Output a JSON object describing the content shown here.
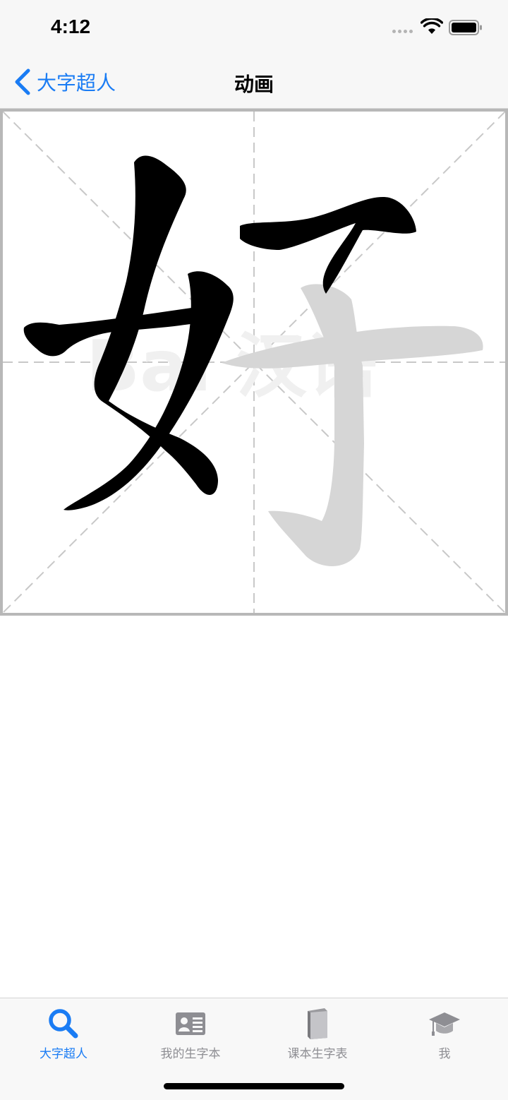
{
  "status_bar": {
    "time": "4:12"
  },
  "nav": {
    "back_label": "大字超人",
    "title": "动画"
  },
  "grid": {
    "character": "好",
    "watermark_text": "Bai 汉语"
  },
  "tabs": [
    {
      "label": "大字超人",
      "icon": "search-icon",
      "active": true
    },
    {
      "label": "我的生字本",
      "icon": "id-card-icon",
      "active": false
    },
    {
      "label": "课本生字表",
      "icon": "book-icon",
      "active": false
    },
    {
      "label": "我",
      "icon": "graduation-cap-icon",
      "active": false
    }
  ],
  "colors": {
    "accent": "#1a7cf4",
    "inactive": "#8e8e93",
    "stroke_done": "#000000",
    "stroke_pending": "#d6d6d6",
    "grid_line": "#c8c8c8"
  }
}
